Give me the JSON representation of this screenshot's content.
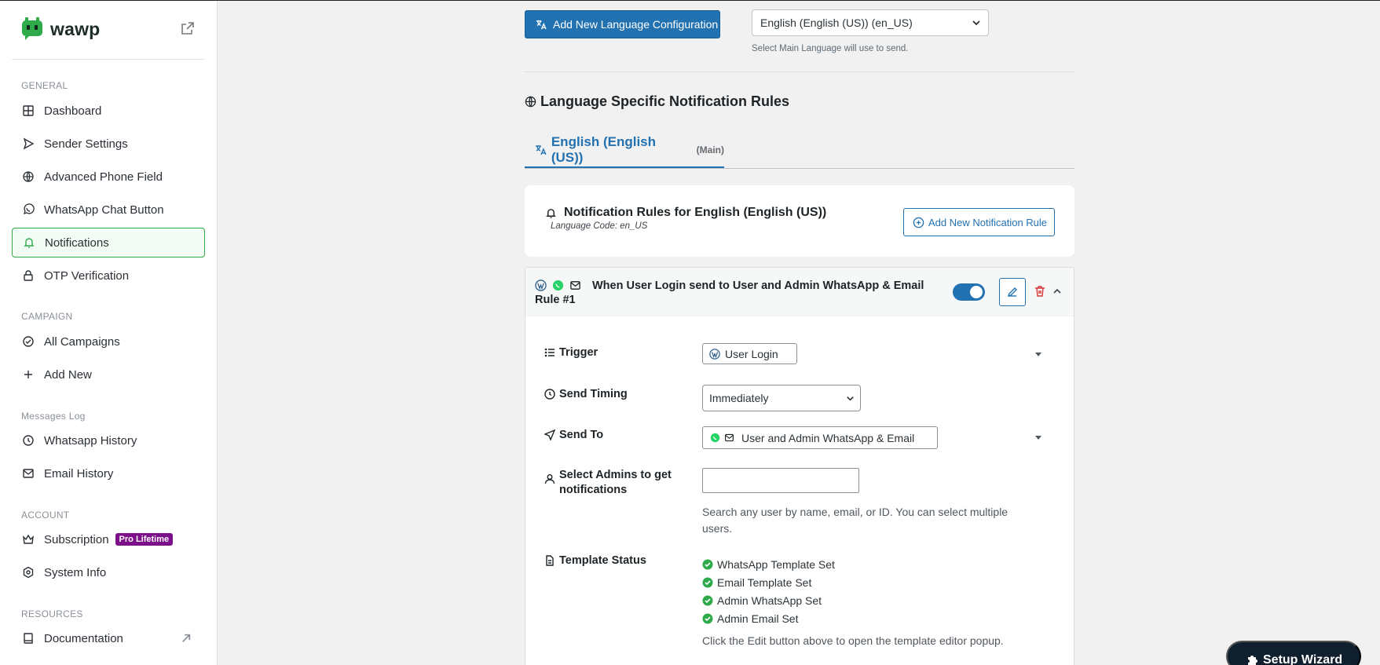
{
  "sidebar": {
    "brand": "wawp",
    "sections": {
      "general": "GENERAL",
      "campaign": "CAMPAIGN",
      "messages_log": "Messages Log",
      "account": "ACCOUNT",
      "resources": "RESOURCES"
    },
    "items": {
      "dashboard": "Dashboard",
      "sender_settings": "Sender Settings",
      "advanced_phone_field": "Advanced Phone Field",
      "whatsapp_chat_button": "WhatsApp Chat Button",
      "notifications": "Notifications",
      "otp_verification": "OTP Verification",
      "all_campaigns": "All Campaigns",
      "add_new": "Add New",
      "whatsapp_history": "Whatsapp History",
      "email_history": "Email History",
      "subscription": "Subscription",
      "subscription_badge": "Pro Lifetime",
      "system_info": "System Info",
      "documentation": "Documentation"
    },
    "active_item": "Notifications",
    "colors": {
      "active_border": "#2eaa4a",
      "badge": "#7c0f8a"
    }
  },
  "top": {
    "add_language_button": "Add New Language Configuration",
    "main_language_value": "English (English (US)) (en_US)",
    "main_language_hint": "Select Main Language will use to send."
  },
  "rules_section": {
    "heading": "Language Specific Notification Rules",
    "tab_label": "English (English (US))",
    "tab_suffix": "(Main)"
  },
  "rules_card": {
    "title": "Notification Rules for English (English (US))",
    "language_code": "Language Code: en_US",
    "add_rule_button": "Add New Notification Rule"
  },
  "rule": {
    "title": "When User Login send to User and Admin WhatsApp & Email Rule #1",
    "enabled": true,
    "header_icons": [
      "wordpress-icon",
      "whatsapp-icon",
      "email-icon"
    ],
    "fields": {
      "trigger_label": "Trigger",
      "trigger_value": "User Login",
      "send_timing_label": "Send Timing",
      "send_timing_value": "Immediately",
      "send_to_label": "Send To",
      "send_to_value": "User and Admin WhatsApp & Email",
      "admins_label": "Select Admins to get notifications",
      "admins_hint": "Search any user by name, email, or ID. You can select multiple users.",
      "template_status_label": "Template Status",
      "template_statuses": [
        "WhatsApp Template Set",
        "Email Template Set",
        "Admin WhatsApp Set",
        "Admin Email Set"
      ],
      "template_hint": "Click the Edit button above to open the template editor popup."
    }
  },
  "wizard_button": "Setup Wizard",
  "colors": {
    "primary": "#2271b1",
    "success": "#2eaa4a",
    "danger": "#d63638",
    "wizard_bg": "#0f1f2e"
  }
}
